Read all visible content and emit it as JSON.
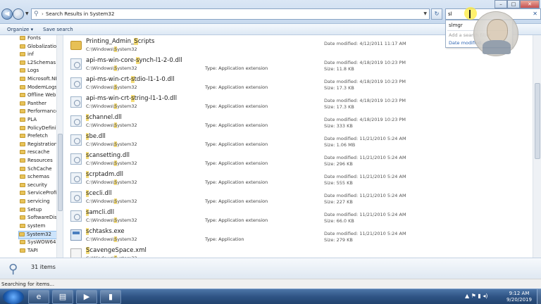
{
  "window": {
    "address": "Search Results in System32",
    "search_value": "sl",
    "buttons": {
      "minimize": "–",
      "maximize": "□",
      "close": "✕"
    }
  },
  "toolbar": {
    "organize": "Organize ▾",
    "save_search": "Save search"
  },
  "suggest": {
    "item": "slmgr",
    "add_filter": "Add a search filter",
    "date_modified": "Date modified:"
  },
  "sidebar": {
    "items": [
      {
        "label": "Fonts"
      },
      {
        "label": "Globalization"
      },
      {
        "label": "inf"
      },
      {
        "label": "L2Schemas"
      },
      {
        "label": "Logs"
      },
      {
        "label": "Microsoft.NET"
      },
      {
        "label": "ModemLogs"
      },
      {
        "label": "Offline Web Pages"
      },
      {
        "label": "Panther"
      },
      {
        "label": "Performance"
      },
      {
        "label": "PLA"
      },
      {
        "label": "PolicyDefinitions"
      },
      {
        "label": "Prefetch"
      },
      {
        "label": "Registration"
      },
      {
        "label": "rescache"
      },
      {
        "label": "Resources"
      },
      {
        "label": "SchCache"
      },
      {
        "label": "schemas"
      },
      {
        "label": "security"
      },
      {
        "label": "ServiceProfiles"
      },
      {
        "label": "servicing"
      },
      {
        "label": "Setup"
      },
      {
        "label": "SoftwareDistribution"
      },
      {
        "label": "system"
      },
      {
        "label": "System32"
      },
      {
        "label": "SysWOW64"
      },
      {
        "label": "TAPI"
      }
    ]
  },
  "results": {
    "items": [
      {
        "name_pre": "Printing_Admin_",
        "name_hl": "S",
        "name_post": "cripts",
        "path_pre": "C:\\Windows\\",
        "path_hl": "S",
        "path_post": "ystem32",
        "type": "",
        "modified": "Date modified: 4/12/2011 11:17 AM",
        "size": "",
        "icon": "folder"
      },
      {
        "name_pre": "api-ms-win-core-",
        "name_hl": "s",
        "name_post": "ynch-l1-2-0.dll",
        "path_pre": "C:\\Windows\\",
        "path_hl": "S",
        "path_post": "ystem32",
        "type": "Type: Application extension",
        "modified": "Date modified: 4/18/2019 10:23 PM",
        "size": "Size: 11.8 KB",
        "icon": "dll"
      },
      {
        "name_pre": "api-ms-win-crt-",
        "name_hl": "s",
        "name_post": "tdio-l1-1-0.dll",
        "path_pre": "C:\\Windows\\",
        "path_hl": "S",
        "path_post": "ystem32",
        "type": "Type: Application extension",
        "modified": "Date modified: 4/18/2019 10:23 PM",
        "size": "Size: 17.3 KB",
        "icon": "dll"
      },
      {
        "name_pre": "api-ms-win-crt-",
        "name_hl": "s",
        "name_post": "tring-l1-1-0.dll",
        "path_pre": "C:\\Windows\\",
        "path_hl": "S",
        "path_post": "ystem32",
        "type": "Type: Application extension",
        "modified": "Date modified: 4/18/2019 10:23 PM",
        "size": "Size: 17.3 KB",
        "icon": "dll"
      },
      {
        "name_pre": "",
        "name_hl": "s",
        "name_post": "channel.dll",
        "path_pre": "C:\\Windows\\",
        "path_hl": "S",
        "path_post": "ystem32",
        "type": "Type: Application extension",
        "modified": "Date modified: 4/18/2019 10:23 PM",
        "size": "Size: 333 KB",
        "icon": "dll"
      },
      {
        "name_pre": "",
        "name_hl": "s",
        "name_post": "be.dll",
        "path_pre": "C:\\Windows\\",
        "path_hl": "S",
        "path_post": "ystem32",
        "type": "Type: Application extension",
        "modified": "Date modified: 11/21/2010 5:24 AM",
        "size": "Size: 1.06 MB",
        "icon": "dll"
      },
      {
        "name_pre": "",
        "name_hl": "s",
        "name_post": "cansetting.dll",
        "path_pre": "C:\\Windows\\",
        "path_hl": "S",
        "path_post": "ystem32",
        "type": "Type: Application extension",
        "modified": "Date modified: 11/21/2010 5:24 AM",
        "size": "Size: 296 KB",
        "icon": "dll"
      },
      {
        "name_pre": "",
        "name_hl": "s",
        "name_post": "crptadm.dll",
        "path_pre": "C:\\Windows\\",
        "path_hl": "S",
        "path_post": "ystem32",
        "type": "Type: Application extension",
        "modified": "Date modified: 11/21/2010 5:24 AM",
        "size": "Size: 555 KB",
        "icon": "dll"
      },
      {
        "name_pre": "",
        "name_hl": "s",
        "name_post": "cecli.dll",
        "path_pre": "C:\\Windows\\",
        "path_hl": "S",
        "path_post": "ystem32",
        "type": "Type: Application extension",
        "modified": "Date modified: 11/21/2010 5:24 AM",
        "size": "Size: 227 KB",
        "icon": "dll"
      },
      {
        "name_pre": "",
        "name_hl": "s",
        "name_post": "amcli.dll",
        "path_pre": "C:\\Windows\\",
        "path_hl": "S",
        "path_post": "ystem32",
        "type": "Type: Application extension",
        "modified": "Date modified: 11/21/2010 5:24 AM",
        "size": "Size: 66.0 KB",
        "icon": "dll"
      },
      {
        "name_pre": "",
        "name_hl": "s",
        "name_post": "chtasks.exe",
        "path_pre": "C:\\Windows\\",
        "path_hl": "S",
        "path_post": "ystem32",
        "type": "Type: Application",
        "modified": "Date modified: 11/21/2010 5:24 AM",
        "size": "Size: 279 KB",
        "icon": "exe"
      },
      {
        "name_pre": "",
        "name_hl": "S",
        "name_post": "cavengeSpace.xml",
        "path_pre": "C:\\Windows\\",
        "path_hl": "S",
        "path_post": "ystem32",
        "type": "",
        "modified": "",
        "size": "",
        "icon": "xml"
      }
    ]
  },
  "details": {
    "count": "31 items"
  },
  "status": {
    "text": "Searching for items..."
  },
  "taskbar": {
    "tray": "▲ ⚑ ▮ ◂)",
    "time": "9:12 AM",
    "date": "9/20/2019"
  }
}
